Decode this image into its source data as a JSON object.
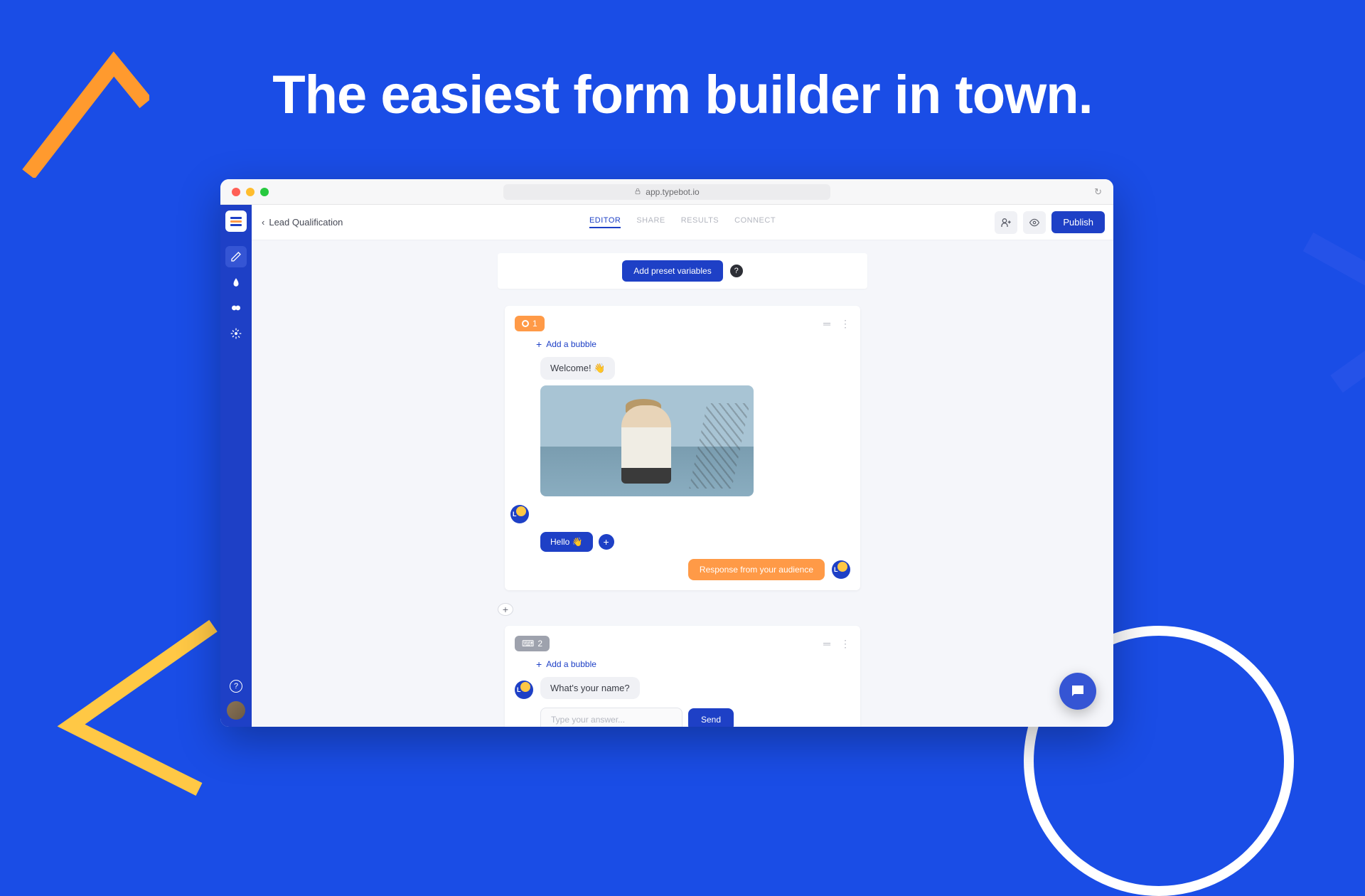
{
  "hero": {
    "headline": "The easiest form builder in town."
  },
  "browser": {
    "url": "app.typebot.io"
  },
  "colors": {
    "brand": "#1e40c6",
    "accent": "#ff9a47",
    "bg": "#1a4de6"
  },
  "topbar": {
    "breadcrumb_label": "Lead Qualification",
    "tabs": [
      "EDITOR",
      "SHARE",
      "RESULTS",
      "CONNECT"
    ],
    "publish_label": "Publish"
  },
  "canvas": {
    "preset_button": "Add preset variables",
    "blocks": [
      {
        "number": "1",
        "add_bubble_label": "Add a bubble",
        "welcome_text": "Welcome! 👋",
        "hello_chip": "Hello 👋",
        "audience_response": "Response from your audience"
      },
      {
        "number": "2",
        "add_bubble_label": "Add a bubble",
        "question_text": "What's your name?",
        "answer_placeholder": "Type your answer...",
        "send_label": "Send"
      }
    ]
  }
}
